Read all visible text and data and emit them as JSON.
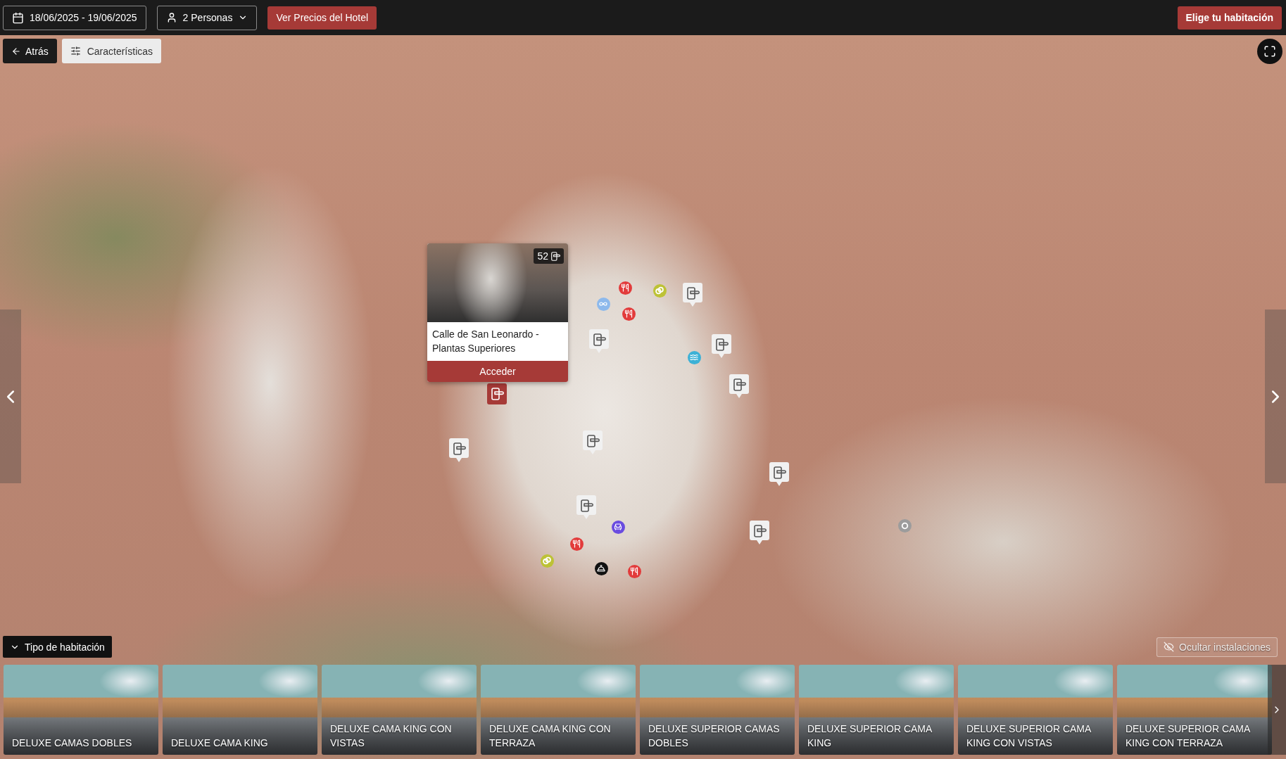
{
  "top_bar": {
    "date_range": "18/06/2025 - 19/06/2025",
    "guests": "2 Personas",
    "prices_button": "Ver Precios del Hotel",
    "choose_room_button": "Elige tu habitación"
  },
  "map_toolbar": {
    "back_button": "Atrás",
    "features_button": "Características"
  },
  "popup": {
    "room_count": "52",
    "title": "Calle de San Leonardo - Plantas Superiores",
    "action_button": "Acceder"
  },
  "room_markers": [
    {
      "selected": false
    },
    {
      "selected": false
    },
    {
      "selected": false
    },
    {
      "selected": true
    },
    {
      "selected": false
    },
    {
      "selected": false
    },
    {
      "selected": false
    },
    {
      "selected": false
    },
    {
      "selected": false
    },
    {
      "selected": false
    }
  ],
  "facility_markers": [
    {
      "kind": "restaurant",
      "color": "#e23b3b"
    },
    {
      "kind": "rings",
      "color": "#bdc236"
    },
    {
      "kind": "infinity",
      "color": "#8db9ec"
    },
    {
      "kind": "restaurant",
      "color": "#e23b3b"
    },
    {
      "kind": "pool",
      "color": "#3db1d6"
    },
    {
      "kind": "meeting",
      "color": "#6a4ce0"
    },
    {
      "kind": "restaurant",
      "color": "#e23b3b"
    },
    {
      "kind": "rings",
      "color": "#bdc236"
    },
    {
      "kind": "bell",
      "color": "#111111"
    },
    {
      "kind": "restaurant",
      "color": "#e23b3b"
    },
    {
      "kind": "ring",
      "color": "#9c9c9c"
    }
  ],
  "room_types": {
    "toggle": "Tipo de habitación",
    "expanded": true,
    "hide_facilities": "Ocultar instalaciones",
    "rooms": [
      "DELUXE CAMAS DOBLES",
      "DELUXE CAMA KING",
      "DELUXE CAMA KING CON VISTAS",
      "DELUXE CAMA KING CON TERRAZA",
      "DELUXE SUPERIOR CAMAS DOBLES",
      "DELUXE SUPERIOR CAMA KING",
      "DELUXE SUPERIOR CAMA KING CON VISTAS",
      "DELUXE SUPERIOR CAMA KING CON TERRAZA"
    ]
  }
}
